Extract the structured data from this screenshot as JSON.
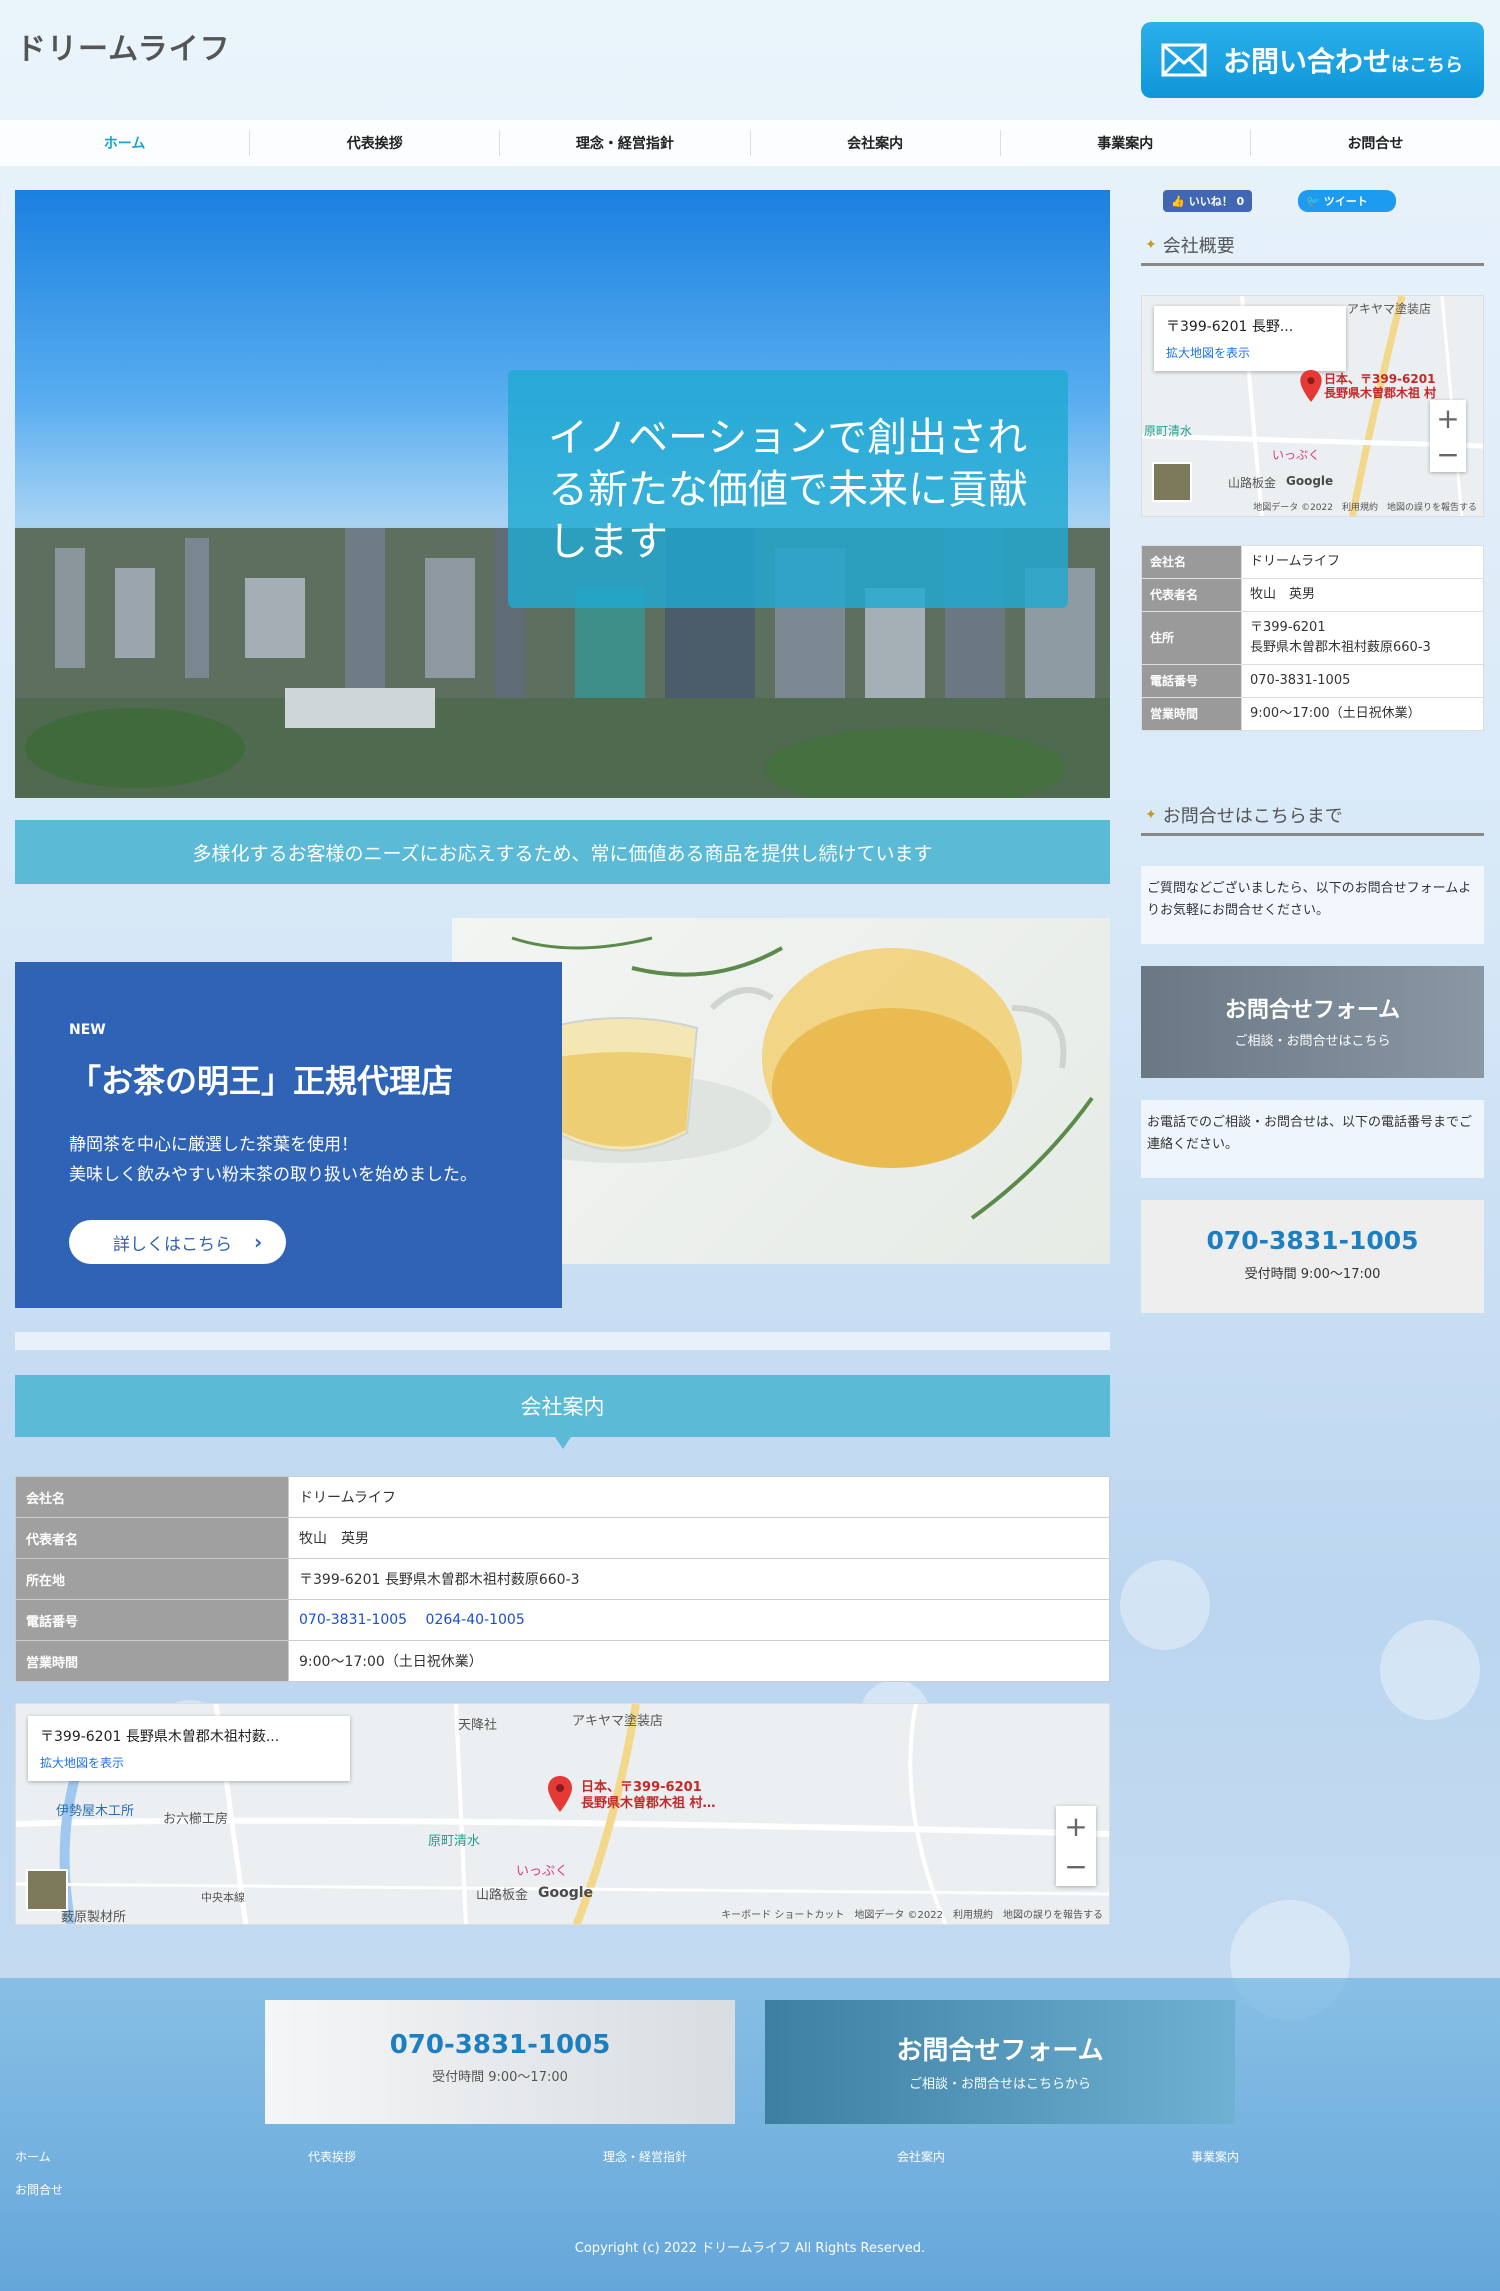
{
  "header": {
    "logo": "ドリームライフ",
    "contact_main": "お問い合わせ",
    "contact_sub": "はこちら"
  },
  "nav": [
    "ホーム",
    "代表挨拶",
    "理念・経営指針",
    "会社案内",
    "事業案内",
    "お問合せ"
  ],
  "hero": {
    "caption": "イノベーションで創出される新たな価値で未来に貢献します"
  },
  "tagline": "多様化するお客様のニーズにお応えするため、常に価値ある商品を提供し続けています",
  "promo": {
    "badge": "NEW",
    "title": "「お茶の明王」正規代理店",
    "desc_line1": "静岡茶を中心に厳選した茶葉を使用！",
    "desc_line2": "美味しく飲みやすい粉末茶の取り扱いを始めました。",
    "button": "詳しくはこちら"
  },
  "company_section": {
    "title": "会社案内",
    "rows": [
      {
        "label": "会社名",
        "value": "ドリームライフ"
      },
      {
        "label": "代表者名",
        "value": "牧山　英男"
      },
      {
        "label": "所在地",
        "value": "〒399-6201 長野県木曽郡木祖村薮原660-3"
      },
      {
        "label": "電話番号",
        "value": ""
      },
      {
        "label": "営業時間",
        "value": "9:00～17:00（土日祝休業）"
      }
    ],
    "phone1": "070-3831-1005",
    "phone2": "0264-40-1005"
  },
  "main_map": {
    "popup_addr": "〒399-6201 長野県木曽郡木祖村薮...",
    "popup_link": "拡大地図を表示",
    "pin_label_1": "日本、〒399-6201",
    "pin_label_2": "長野県木曽郡木祖 村…",
    "places": [
      "天降社",
      "アキヤマ塗装店",
      "伊勢屋木工所",
      "お六櫛工房",
      "原町清水",
      "いっぷく",
      "山路板金",
      "薮原製材所",
      "中央本線"
    ],
    "google": "Google",
    "footer": "キーボード ショートカット　地図データ ©2022　利用規約　地図の誤りを報告する"
  },
  "sidebar": {
    "like": "いいね！ 0",
    "tweet": "ツイート",
    "overview_title": "会社概要",
    "map_popup": "〒399-6201 長野...",
    "map_link": "拡大地図を表示",
    "map_pin_1": "日本、〒399-6201",
    "map_pin_2": "長野県木曽郡木祖 村",
    "map_places": [
      "アキヤマ塗装店",
      "原町清水",
      "いっぷく",
      "山路板金"
    ],
    "map_footer": "地図データ ©2022　利用規約　地図の誤りを報告する",
    "table": [
      {
        "label": "会社名",
        "value": "ドリームライフ"
      },
      {
        "label": "代表者名",
        "value": "牧山　英男"
      },
      {
        "label": "住所",
        "value": "〒399-6201\n長野県木曽郡木祖村薮原660-3"
      },
      {
        "label": "電話番号",
        "value": "070-3831-1005"
      },
      {
        "label": "営業時間",
        "value": "9:00～17:00（土日祝休業）"
      }
    ],
    "contact_title": "お問合せはこちらまで",
    "contact_text": "ご質問などございましたら、以下のお問合せフォームよりお気軽にお問合せください。",
    "form_banner_title": "お問合せフォーム",
    "form_banner_sub": "ご相談・お問合せはこちら",
    "phone_text": "お電話でのご相談・お問合せは、以下の電話番号までご連絡ください。",
    "phone": "070-3831-1005",
    "hours": "受付時間 9:00～17:00"
  },
  "footer": {
    "tel_banner": "070-3831-1005",
    "tel_hours": "受付時間 9:00～17:00",
    "form_banner": "お問合せフォーム",
    "form_sub": "ご相談・お問合せはこちらから",
    "nav": [
      "ホーム",
      "代表挨拶",
      "理念・経営指針",
      "会社案内",
      "事業案内",
      "お問合せ"
    ],
    "copyright": "Copyright (c) 2022 ドリームライフ All Rights Reserved."
  },
  "colors": {
    "accent": "#5bbad5",
    "promo_blue": "#2f63b6",
    "contact_blue": "#1aa2e3",
    "tel_blue": "#1b7fc1"
  }
}
